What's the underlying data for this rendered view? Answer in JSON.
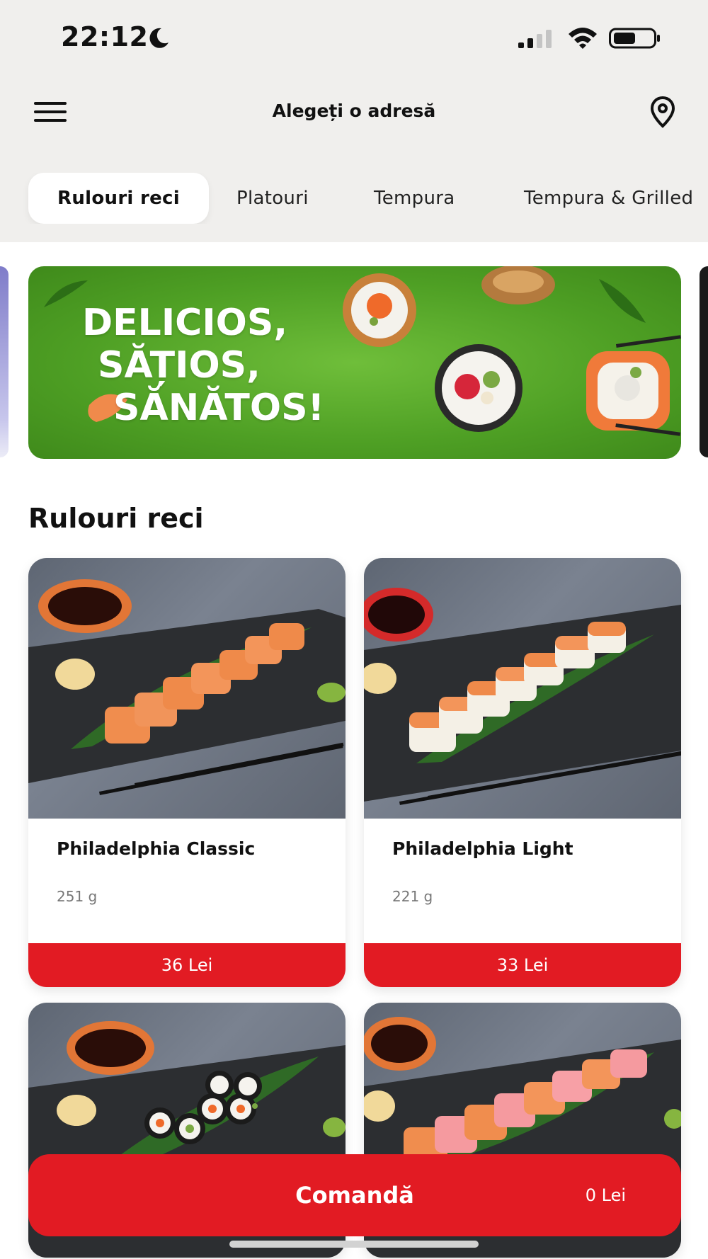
{
  "status_bar": {
    "time": "22:12",
    "icons": [
      "moon-icon",
      "signal-icon",
      "wifi-icon",
      "battery-icon"
    ]
  },
  "topbar": {
    "menu_icon": "hamburger-menu-icon",
    "address_label": "Alegeți o adresă",
    "location_icon": "map-pin-icon"
  },
  "tabs": [
    {
      "label": "Rulouri reci",
      "active": true
    },
    {
      "label": "Platouri",
      "active": false
    },
    {
      "label": "Tempura",
      "active": false
    },
    {
      "label": "Tempura & Grilled",
      "active": false
    }
  ],
  "banner": {
    "lines": [
      "DELICIOS,",
      "SĂȚIOS,",
      "SĂNĂTOS!"
    ]
  },
  "section_title": "Rulouri reci",
  "products": [
    {
      "name": "Philadelphia Classic",
      "weight": "251 g",
      "price": "36 Lei"
    },
    {
      "name": "Philadelphia Light",
      "weight": "221 g",
      "price": "33 Lei"
    }
  ],
  "order_bar": {
    "label": "Comandă",
    "total": "0 Lei"
  },
  "colors": {
    "accent_red": "#e21b23",
    "banner_green": "#4e9f24",
    "header_bg": "#f0efed"
  }
}
